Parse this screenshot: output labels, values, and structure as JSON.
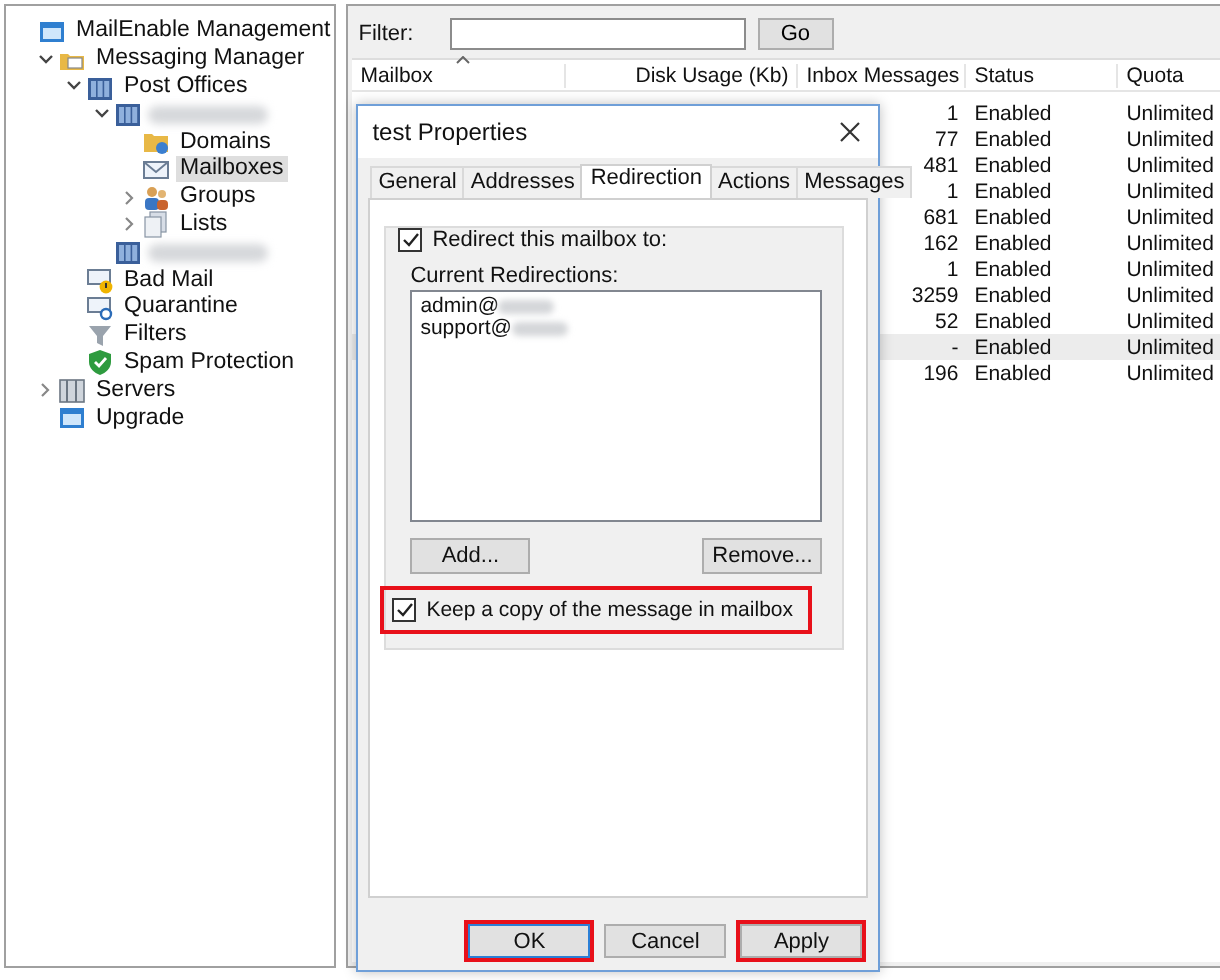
{
  "tree": [
    {
      "label": "MailEnable Management",
      "kind": "console",
      "selected": false,
      "children": [
        {
          "label": "Messaging Manager",
          "kind": "mail-folder",
          "expanded": true,
          "selected": false,
          "children": [
            {
              "label": "Post Offices",
              "kind": "post-office",
              "expanded": true,
              "selected": false,
              "children": [
                {
                  "kind": "redacted",
                  "expanded": true,
                  "selected": false,
                  "children": [
                    {
                      "label": "Domains",
                      "kind": "domain",
                      "selected": false
                    },
                    {
                      "label": "Mailboxes",
                      "kind": "mailbox",
                      "selected": true
                    },
                    {
                      "label": "Groups",
                      "kind": "group",
                      "expanded": false,
                      "selected": false
                    },
                    {
                      "label": "Lists",
                      "kind": "list",
                      "expanded": false,
                      "selected": false
                    }
                  ]
                },
                {
                  "kind": "redacted",
                  "selected": false
                }
              ]
            },
            {
              "label": "Bad Mail",
              "kind": "bad-mail",
              "selected": false
            },
            {
              "label": "Quarantine",
              "kind": "quarantine",
              "selected": false
            },
            {
              "label": "Filters",
              "kind": "filter",
              "selected": false
            },
            {
              "label": "Spam Protection",
              "kind": "shield",
              "selected": false
            }
          ]
        },
        {
          "label": "Servers",
          "kind": "server",
          "expanded": false,
          "selected": false
        },
        {
          "label": "Upgrade",
          "kind": "console",
          "selected": false
        }
      ]
    }
  ],
  "filter": {
    "label": "Filter:",
    "button": "Go"
  },
  "table": {
    "columns": [
      "Mailbox",
      "Disk Usage (Kb)",
      "Inbox Messages",
      "Status",
      "Quota"
    ],
    "rows": [
      {
        "inbox_messages": "1",
        "status": "Enabled",
        "quota": "Unlimited",
        "selected": false
      },
      {
        "inbox_messages": "77",
        "status": "Enabled",
        "quota": "Unlimited",
        "selected": false
      },
      {
        "inbox_messages": "481",
        "status": "Enabled",
        "quota": "Unlimited",
        "selected": false
      },
      {
        "inbox_messages": "1",
        "status": "Enabled",
        "quota": "Unlimited",
        "selected": false
      },
      {
        "inbox_messages": "681",
        "status": "Enabled",
        "quota": "Unlimited",
        "selected": false
      },
      {
        "inbox_messages": "162",
        "status": "Enabled",
        "quota": "Unlimited",
        "selected": false
      },
      {
        "inbox_messages": "1",
        "status": "Enabled",
        "quota": "Unlimited",
        "selected": false
      },
      {
        "inbox_messages": "3259",
        "status": "Enabled",
        "quota": "Unlimited",
        "selected": false
      },
      {
        "inbox_messages": "52",
        "status": "Enabled",
        "quota": "Unlimited",
        "selected": false
      },
      {
        "inbox_messages": "-",
        "status": "Enabled",
        "quota": "Unlimited",
        "selected": true
      },
      {
        "inbox_messages": "196",
        "status": "Enabled",
        "quota": "Unlimited",
        "selected": false
      }
    ]
  },
  "dialog": {
    "title": "test Properties",
    "tabs": [
      {
        "label": "General",
        "selected": false
      },
      {
        "label": "Addresses",
        "selected": false
      },
      {
        "label": "Redirection",
        "selected": true
      },
      {
        "label": "Actions",
        "selected": false
      },
      {
        "label": "Messages",
        "selected": false
      }
    ],
    "redirect": {
      "label": "Redirect this mailbox to:",
      "checked": true
    },
    "list_label": "Current Redirections:",
    "redirections": [
      {
        "text": "admin@",
        "redacted": true
      },
      {
        "text": "support@",
        "redacted": true
      }
    ],
    "list_buttons": [
      "Add...",
      "Remove..."
    ],
    "keep_copy": {
      "label": "Keep a copy of the message in mailbox",
      "checked": true,
      "highlighted": true
    },
    "buttons": [
      {
        "label": "OK",
        "highlighted": true,
        "focused": true
      },
      {
        "label": "Cancel",
        "highlighted": false,
        "focused": false
      },
      {
        "label": "Apply",
        "highlighted": true,
        "focused": false
      }
    ]
  }
}
